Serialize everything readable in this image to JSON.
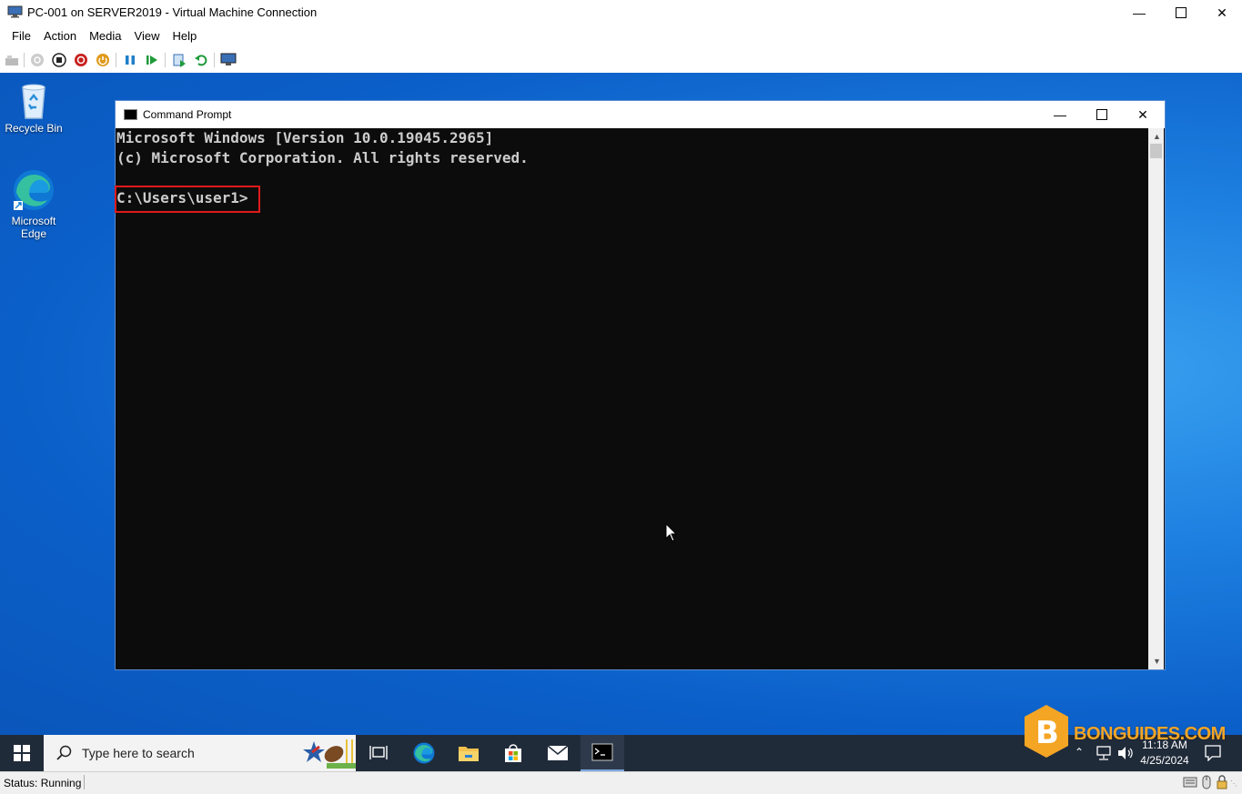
{
  "vm_window": {
    "title": "PC-001 on SERVER2019 - Virtual Machine Connection",
    "menu": [
      "File",
      "Action",
      "Media",
      "View",
      "Help"
    ]
  },
  "desktop": {
    "icons": [
      {
        "label_line1": "Recycle Bin",
        "label_line2": "",
        "icon": "recycle-bin-icon"
      },
      {
        "label_line1": "Microsoft",
        "label_line2": "Edge",
        "icon": "edge-icon"
      }
    ]
  },
  "cmd_window": {
    "title": "Command Prompt",
    "lines": [
      "Microsoft Windows [Version 10.0.19045.2965]",
      "(c) Microsoft Corporation. All rights reserved.",
      "C:\\Users\\user1>"
    ]
  },
  "taskbar": {
    "search_placeholder": "Type here to search",
    "time": "11:18 AM",
    "date": "4/25/2024",
    "apps": [
      "task-view",
      "edge",
      "file-explorer",
      "store",
      "mail",
      "command-prompt"
    ]
  },
  "watermark": {
    "text": "BONGUIDES.COM",
    "letter": "B"
  },
  "status": {
    "text": "Status: Running"
  },
  "colors": {
    "desktop": "#0b5fc8",
    "console_bg": "#0c0c0c",
    "highlight": "#e01a1a",
    "taskbar": "#202b3a"
  }
}
